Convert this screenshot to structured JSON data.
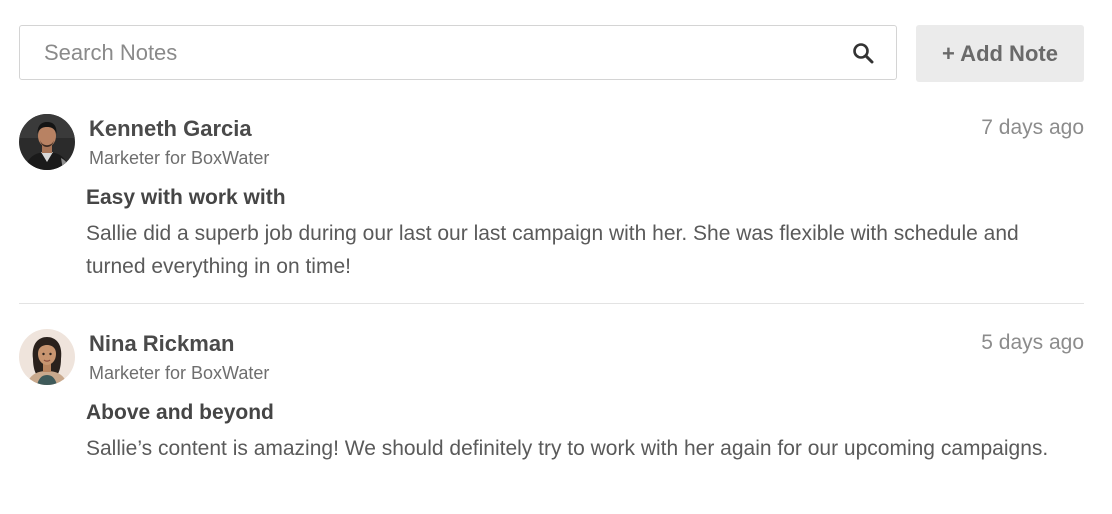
{
  "toolbar": {
    "search_placeholder": "Search Notes",
    "search_icon": "search-icon",
    "add_note_label": "+ Add Note"
  },
  "notes": [
    {
      "author": "Kenneth Garcia",
      "role": "Marketer for BoxWater",
      "time": "7 days ago",
      "title": "Easy with work with",
      "body": "Sallie did a superb job during our last our last campaign with her. She was flexible with schedule and turned everything in on time!"
    },
    {
      "author": "Nina Rickman",
      "role": "Marketer for BoxWater",
      "time": "5 days ago",
      "title": "Above and beyond",
      "body": "Sallie’s content is amazing! We should definitely try to work with her again for our upcoming campaigns."
    }
  ],
  "colors": {
    "border": "#d4d4d4",
    "button_bg": "#ebebeb",
    "divider": "#e3e3e3",
    "text": "#4a4a4a"
  }
}
